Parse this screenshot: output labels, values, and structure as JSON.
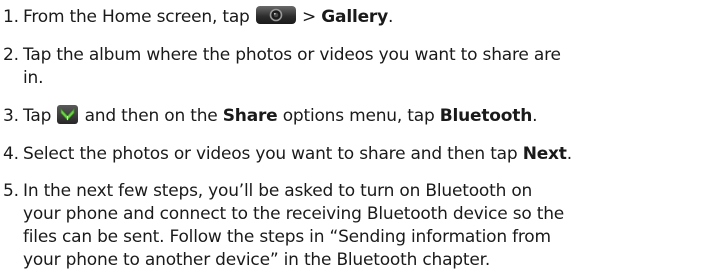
{
  "steps": [
    {
      "number": "1.",
      "before": "From the Home screen, tap ",
      "icon": "camera-icon",
      "middle": " > ",
      "bold": "Gallery",
      "after": "."
    },
    {
      "number": "2.",
      "line1": "Tap the album where the photos or videos you want to share are",
      "line2": "in."
    },
    {
      "number": "3.",
      "a": "Tap ",
      "icon": "menu-icon",
      "b": " and then on the ",
      "bold1": "Share",
      "c": " options menu, tap ",
      "bold2": "Bluetooth",
      "d": "."
    },
    {
      "number": "4.",
      "a": "Select the photos or videos you want to share and then tap ",
      "bold": "Next",
      "b": "."
    },
    {
      "number": "5.",
      "lines": [
        "In the next few steps, you’ll be asked to turn on Bluetooth on",
        "your phone and connect to the receiving Bluetooth device so the",
        "files can be sent. Follow the steps in “Sending information from",
        "your phone to another device” in the Bluetooth chapter."
      ]
    }
  ]
}
